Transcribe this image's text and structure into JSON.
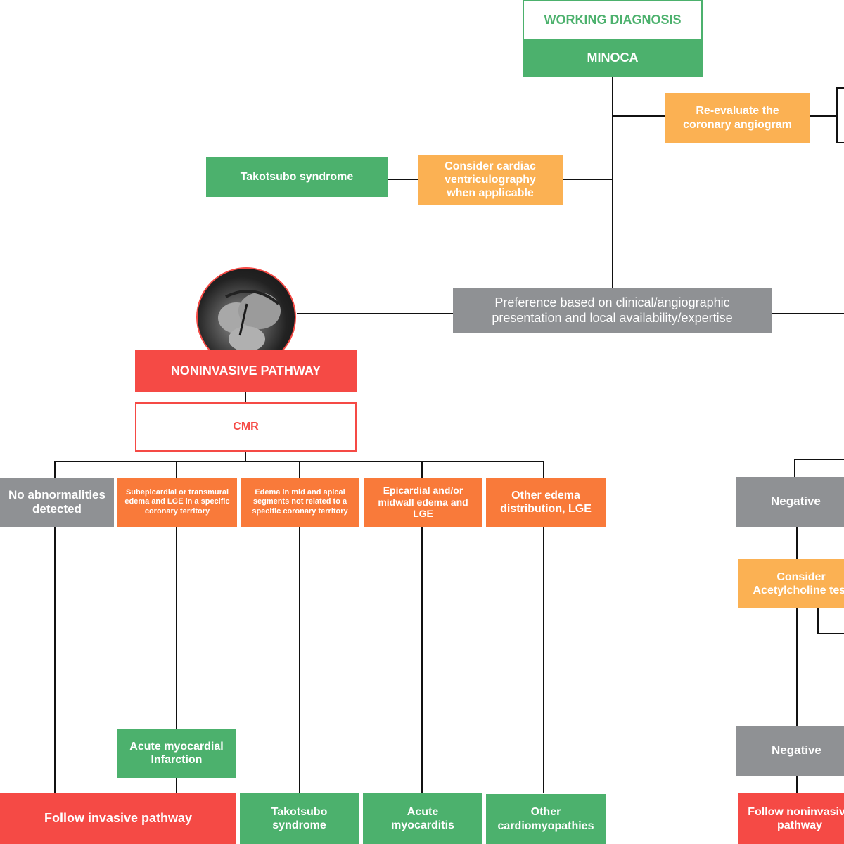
{
  "colors": {
    "green": "#4cb16d",
    "light_orange": "#fbb153",
    "orange": "#f97a3a",
    "red": "#f54a45",
    "gray": "#8f9194",
    "line": "#111111"
  },
  "header": {
    "title": "WORKING DIAGNOSIS",
    "diagnosis": "MINOCA"
  },
  "top_branch": {
    "reevaluate": "Re-evaluate the coronary angiogram",
    "ventriculography": "Consider cardiac ventriculography when applicable",
    "takotsubo": "Takotsubo syndrome"
  },
  "preference": "Preference based on clinical/angiographic presentation and local availability/expertise",
  "noninvasive": {
    "image_icon": "cardiac-mri-image",
    "title": "NONINVASIVE PATHWAY",
    "test": "CMR",
    "findings": [
      "No abnormalities detected",
      "Subepicardial or transmural edema and LGE in a specific coronary territory",
      "Edema in mid and apical segments not related to a specific coronary territory",
      "Epicardial and/or midwall edema and LGE",
      "Other edema distribution, LGE"
    ],
    "intermediate": "Acute myocardial Infarction",
    "outcomes": [
      "Follow invasive pathway",
      "Takotsubo syndrome",
      "Acute myocarditis",
      "Other cardiomyopathies"
    ]
  },
  "invasive_partial": {
    "negative_1": "Negative",
    "acetylcholine": "Consider Acetylcholine test",
    "negative_2": "Negative",
    "follow": "Follow noninvasive pathway"
  }
}
